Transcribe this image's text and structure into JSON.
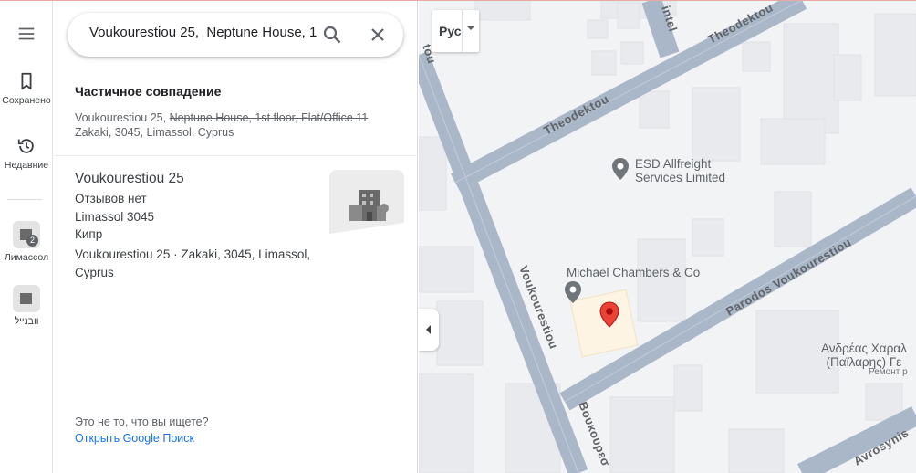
{
  "rail": {
    "saved_label": "Сохранено",
    "recent_label": "Недавние",
    "place1_label": "Лимассол",
    "place1_badge": "2",
    "place2_label": "וובנייל"
  },
  "search": {
    "value": "Voukourestiou 25,  Neptune House, 1",
    "icons": {
      "search": "search-icon",
      "close": "close-icon"
    }
  },
  "partial_match": {
    "title": "Частичное совпадение",
    "address_plain": "Voukourestiou 25,",
    "address_struck": "Neptune House, 1st floor, Flat/Office 11",
    "address_rest": "Zakaki, 3045, Limassol, Cyprus"
  },
  "result": {
    "name": "Voukourestiou 25",
    "reviews": "Отзывов нет",
    "line2": "Limassol 3045",
    "line3": "Кипр",
    "line4": "Voukourestiou 25 · Zakaki, 3045, Limassol, Cyprus"
  },
  "footer": {
    "prompt": "Это не то, что вы ищете?",
    "link": "Открыть Google Поиск"
  },
  "map": {
    "layer_label": "Рус",
    "streets": {
      "theodektou_1": "Theodektou",
      "theodektou_2": "Theodektou",
      "voukourestiou": "Voukourestiou",
      "parodos": "Parodos Voukourestiou",
      "voukourestiou_gr": "Βουκουρεσ",
      "avrosynis": "Avrosynis",
      "intel": "intel",
      "tou": "tou"
    },
    "pois": {
      "esd_line1": "ESD Allfreight",
      "esd_line2": "Services Limited",
      "chambers": "Michael Chambers & Co",
      "andreas_line1": "Ανδρέας Χαραλ",
      "andreas_line2": "(Παϊλαρης) Γε",
      "andreas_sub": "Ремонт р"
    },
    "colors": {
      "road": "#aab7c8",
      "building": "#e8eaed",
      "selected_building": "#fdf4e3",
      "pin_red": "#ea4335",
      "poi_gray": "#70757a"
    }
  }
}
